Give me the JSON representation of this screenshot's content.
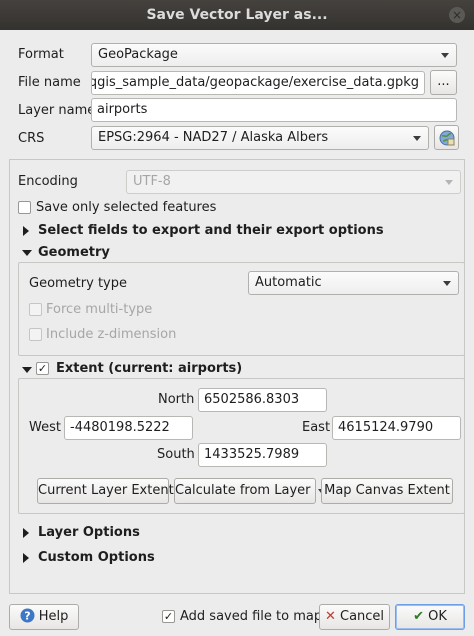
{
  "window": {
    "title": "Save Vector Layer as...",
    "close_glyph": "×"
  },
  "form": {
    "format": {
      "label": "Format",
      "value": "GeoPackage"
    },
    "file_name": {
      "label": "File name",
      "value": "qgis_sample_data/geopackage/exercise_data.gpkg",
      "browse_label": "..."
    },
    "layer_name": {
      "label": "Layer name",
      "value": "airports"
    },
    "crs": {
      "label": "CRS",
      "value": "EPSG:2964 - NAD27 / Alaska Albers"
    }
  },
  "encoding": {
    "label": "Encoding",
    "value": "UTF-8"
  },
  "save_selected": {
    "label": "Save only selected features",
    "checked": false
  },
  "select_fields": {
    "label": "Select fields to export and their export options"
  },
  "geometry": {
    "title": "Geometry",
    "type_label": "Geometry type",
    "type_value": "Automatic",
    "force_multi": "Force multi-type",
    "include_z": "Include z-dimension"
  },
  "extent": {
    "title": "Extent (current: airports)",
    "checked": true,
    "north_label": "North",
    "north_value": "6502586.8303",
    "west_label": "West",
    "west_value": "-4480198.5222",
    "east_label": "East",
    "east_value": "4615124.9790",
    "south_label": "South",
    "south_value": "1433525.7989",
    "current_layer_btn": "Current Layer Extent",
    "calculate_btn": "Calculate from Layer",
    "map_canvas_btn": "Map Canvas Extent"
  },
  "layer_options": {
    "label": "Layer Options"
  },
  "custom_options": {
    "label": "Custom Options"
  },
  "footer": {
    "help": "Help",
    "add_saved": "Add saved file to map",
    "add_saved_checked": true,
    "cancel": "Cancel",
    "ok": "OK"
  }
}
